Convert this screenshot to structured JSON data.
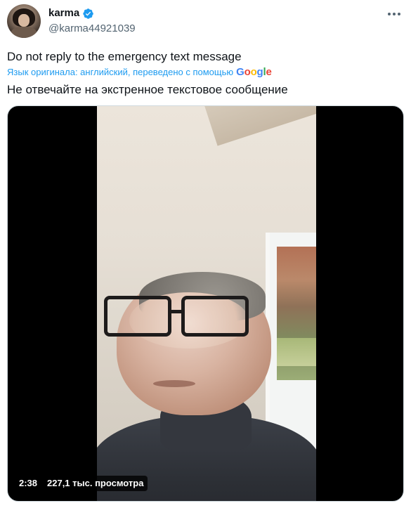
{
  "author": {
    "display_name": "karma",
    "handle": "@karma44921039",
    "verified_icon": "verified-badge-icon",
    "badge_color": "#1d9bf0"
  },
  "tweet": {
    "text": "Do not reply to the emergency text message",
    "translation_label": "Язык оригинала: английский, переведено с помощью",
    "translation_provider": [
      "G",
      "o",
      "o",
      "g",
      "l",
      "e"
    ],
    "translated_text": "Не отвечайте на экстренное текстовое сообщение"
  },
  "video": {
    "duration": "2:38",
    "views": "227,1 тыс. просмотра"
  },
  "colors": {
    "text": "#0f1419",
    "secondary": "#536471",
    "link": "#1d9bf0"
  }
}
